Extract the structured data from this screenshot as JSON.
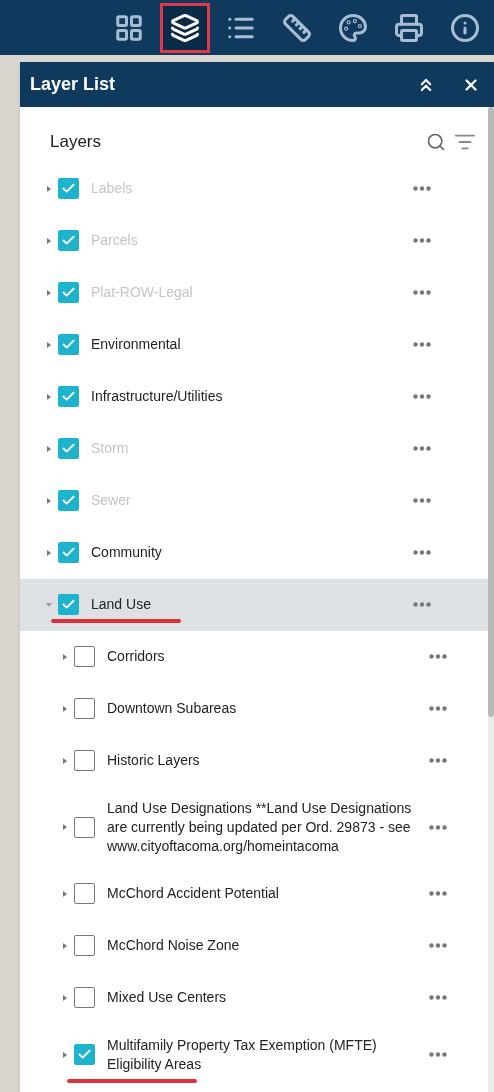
{
  "toolbar": {
    "buttons": [
      {
        "kind": "grid",
        "selected": false
      },
      {
        "kind": "layers",
        "selected": true
      },
      {
        "kind": "legend",
        "selected": false
      },
      {
        "kind": "ruler",
        "selected": false
      },
      {
        "kind": "palette",
        "selected": false
      },
      {
        "kind": "print",
        "selected": false
      },
      {
        "kind": "info",
        "selected": false
      }
    ]
  },
  "panel": {
    "title": "Layer List",
    "section_title": "Layers",
    "layers": [
      {
        "name": "Labels",
        "checked": true,
        "dimmed": true,
        "expanded": false,
        "selected": false,
        "underlined": false
      },
      {
        "name": "Parcels",
        "checked": true,
        "dimmed": true,
        "expanded": false,
        "selected": false,
        "underlined": false
      },
      {
        "name": "Plat-ROW-Legal",
        "checked": true,
        "dimmed": true,
        "expanded": false,
        "selected": false,
        "underlined": false
      },
      {
        "name": "Environmental",
        "checked": true,
        "dimmed": false,
        "expanded": false,
        "selected": false,
        "underlined": false
      },
      {
        "name": "Infrastructure/Utilities",
        "checked": true,
        "dimmed": false,
        "expanded": false,
        "selected": false,
        "underlined": false
      },
      {
        "name": "Storm",
        "checked": true,
        "dimmed": true,
        "expanded": false,
        "selected": false,
        "underlined": false
      },
      {
        "name": "Sewer",
        "checked": true,
        "dimmed": true,
        "expanded": false,
        "selected": false,
        "underlined": false
      },
      {
        "name": "Community",
        "checked": true,
        "dimmed": false,
        "expanded": false,
        "selected": false,
        "underlined": false
      },
      {
        "name": "Land Use",
        "checked": true,
        "dimmed": false,
        "expanded": true,
        "selected": true,
        "underlined": true,
        "children": [
          {
            "name": "Corridors",
            "checked": false,
            "dimmed": false,
            "expanded": false,
            "selected": false,
            "underlined": false
          },
          {
            "name": "Downtown Subareas",
            "checked": false,
            "dimmed": false,
            "expanded": false,
            "selected": false,
            "underlined": false
          },
          {
            "name": "Historic Layers",
            "checked": false,
            "dimmed": false,
            "expanded": false,
            "selected": false,
            "underlined": false
          },
          {
            "name": "Land Use Designations **Land Use Designations are currently being updated per Ord. 29873 - see www.cityoftacoma.org/homeintacoma",
            "checked": false,
            "dimmed": false,
            "expanded": false,
            "selected": false,
            "underlined": false
          },
          {
            "name": "McChord Accident Potential",
            "checked": false,
            "dimmed": false,
            "expanded": false,
            "selected": false,
            "underlined": false
          },
          {
            "name": "McChord Noise Zone",
            "checked": false,
            "dimmed": false,
            "expanded": false,
            "selected": false,
            "underlined": false
          },
          {
            "name": "Mixed Use Centers",
            "checked": false,
            "dimmed": false,
            "expanded": false,
            "selected": false,
            "underlined": false
          },
          {
            "name": "Multifamily Property Tax Exemption (MFTE) Eligibility Areas",
            "checked": true,
            "dimmed": false,
            "expanded": false,
            "selected": false,
            "underlined": true
          }
        ]
      }
    ]
  }
}
